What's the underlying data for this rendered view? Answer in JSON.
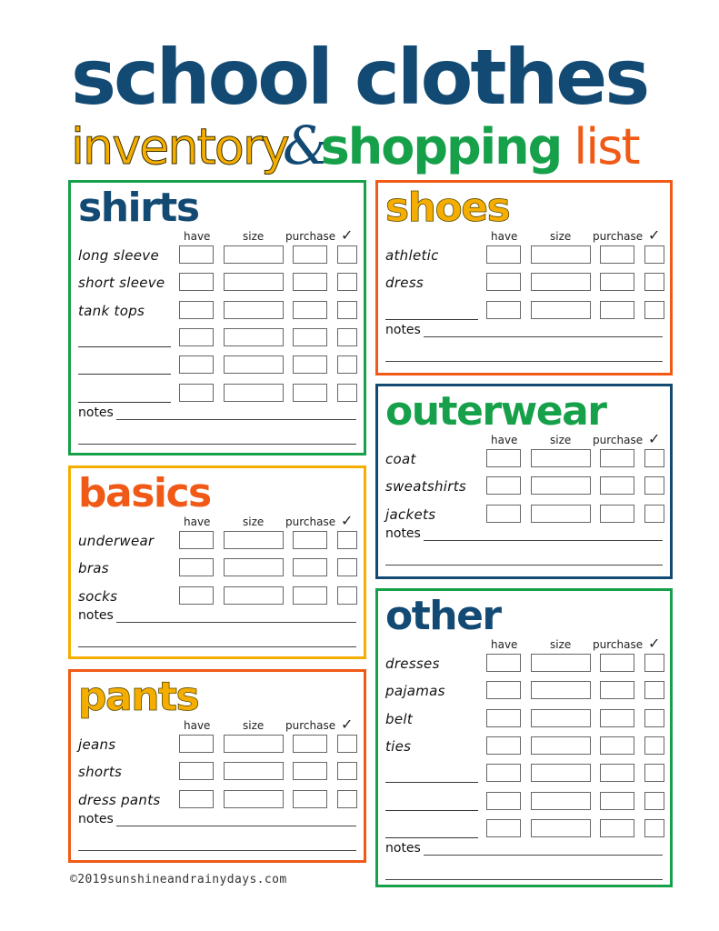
{
  "title": {
    "line1": "school clothes",
    "inventory": "inventory",
    "ampersand": "&",
    "shopping": "shopping",
    "list": "list"
  },
  "columns": {
    "have": "have",
    "size": "size",
    "purchase": "purchase",
    "check": "✓"
  },
  "notes_label": "notes",
  "colors": {
    "navy": "#124a73",
    "green": "#16a04a",
    "orange": "#f05a16",
    "yellow": "#f5ae00"
  },
  "sections": {
    "shirts": {
      "title": "shirts",
      "rows": [
        "long sleeve",
        "short sleeve",
        "tank tops",
        "",
        "",
        ""
      ]
    },
    "basics": {
      "title": "basics",
      "rows": [
        "underwear",
        "bras",
        "socks"
      ]
    },
    "pants": {
      "title": "pants",
      "rows": [
        "jeans",
        "shorts",
        "dress pants"
      ]
    },
    "shoes": {
      "title": "shoes",
      "rows": [
        "athletic",
        "dress",
        ""
      ]
    },
    "outerwear": {
      "title": "outerwear",
      "rows": [
        "coat",
        "sweatshirts",
        "jackets"
      ]
    },
    "other": {
      "title": "other",
      "rows": [
        "dresses",
        "pajamas",
        "belt",
        "ties",
        "",
        "",
        ""
      ]
    }
  },
  "footer": {
    "copyright": "©2019sunshineandrainydays.com"
  }
}
